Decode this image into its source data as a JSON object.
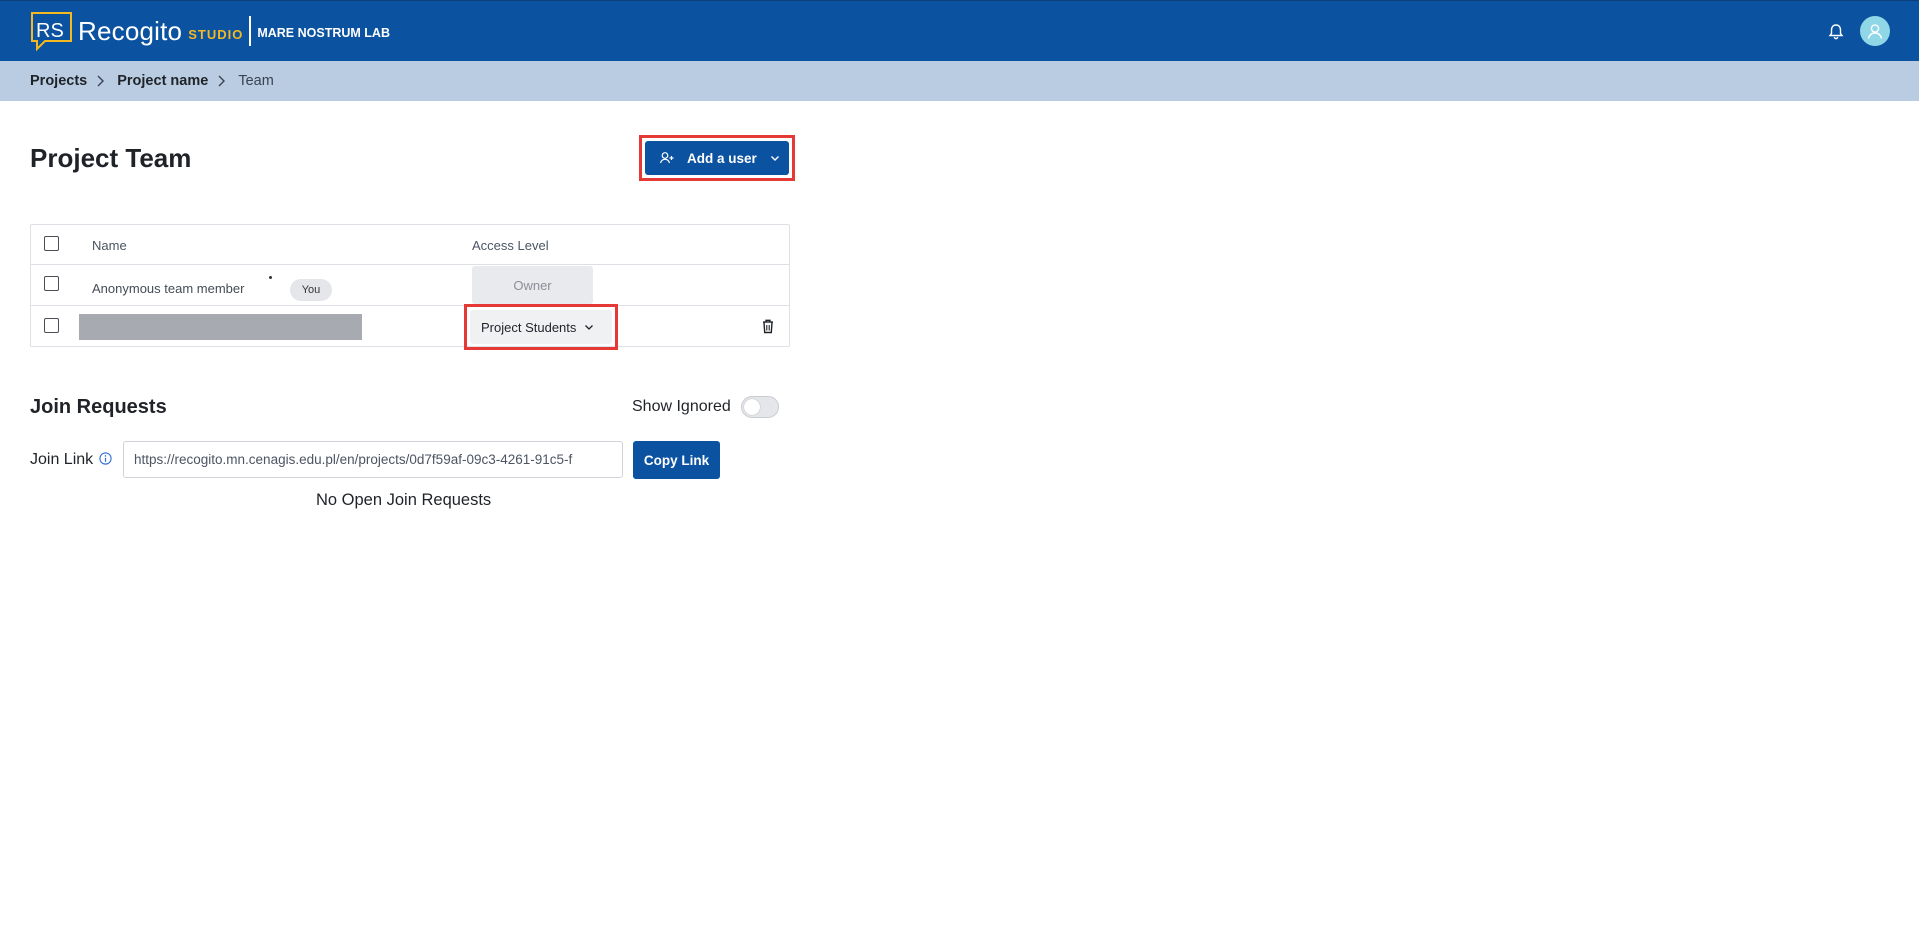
{
  "header": {
    "brand_initials": "RS",
    "brand_name": "Recogito",
    "brand_studio": "STUDIO",
    "brand_lab": "MARE NOSTRUM LAB",
    "bell_icon": "bell-icon",
    "avatar_icon": "user-avatar-icon",
    "colors": {
      "bar": "#0b52a0",
      "studio": "#f5b820",
      "avatar": "#8fd6e6"
    }
  },
  "breadcrumb": {
    "items": [
      {
        "label": "Projects"
      },
      {
        "label": "Project name"
      },
      {
        "label": "Team"
      }
    ]
  },
  "page": {
    "title": "Project Team",
    "add_user_label": "Add a user"
  },
  "team_table": {
    "columns": [
      "Name",
      "Access Level"
    ],
    "rows": [
      {
        "name": "Anonymous team member",
        "badge": "You",
        "access": "Owner"
      },
      {
        "name": "",
        "access": "Project Students"
      }
    ]
  },
  "join_requests": {
    "title": "Join Requests",
    "show_ignored_label": "Show Ignored",
    "show_ignored_on": false,
    "join_link_label": "Join Link",
    "join_link_value": "https://recogito.mn.cenagis.edu.pl/en/projects/0d7f59af-09c3-4261-91c5-f",
    "copy_label": "Copy Link",
    "empty_message": "No Open Join Requests"
  },
  "highlight_color": "#e53935"
}
